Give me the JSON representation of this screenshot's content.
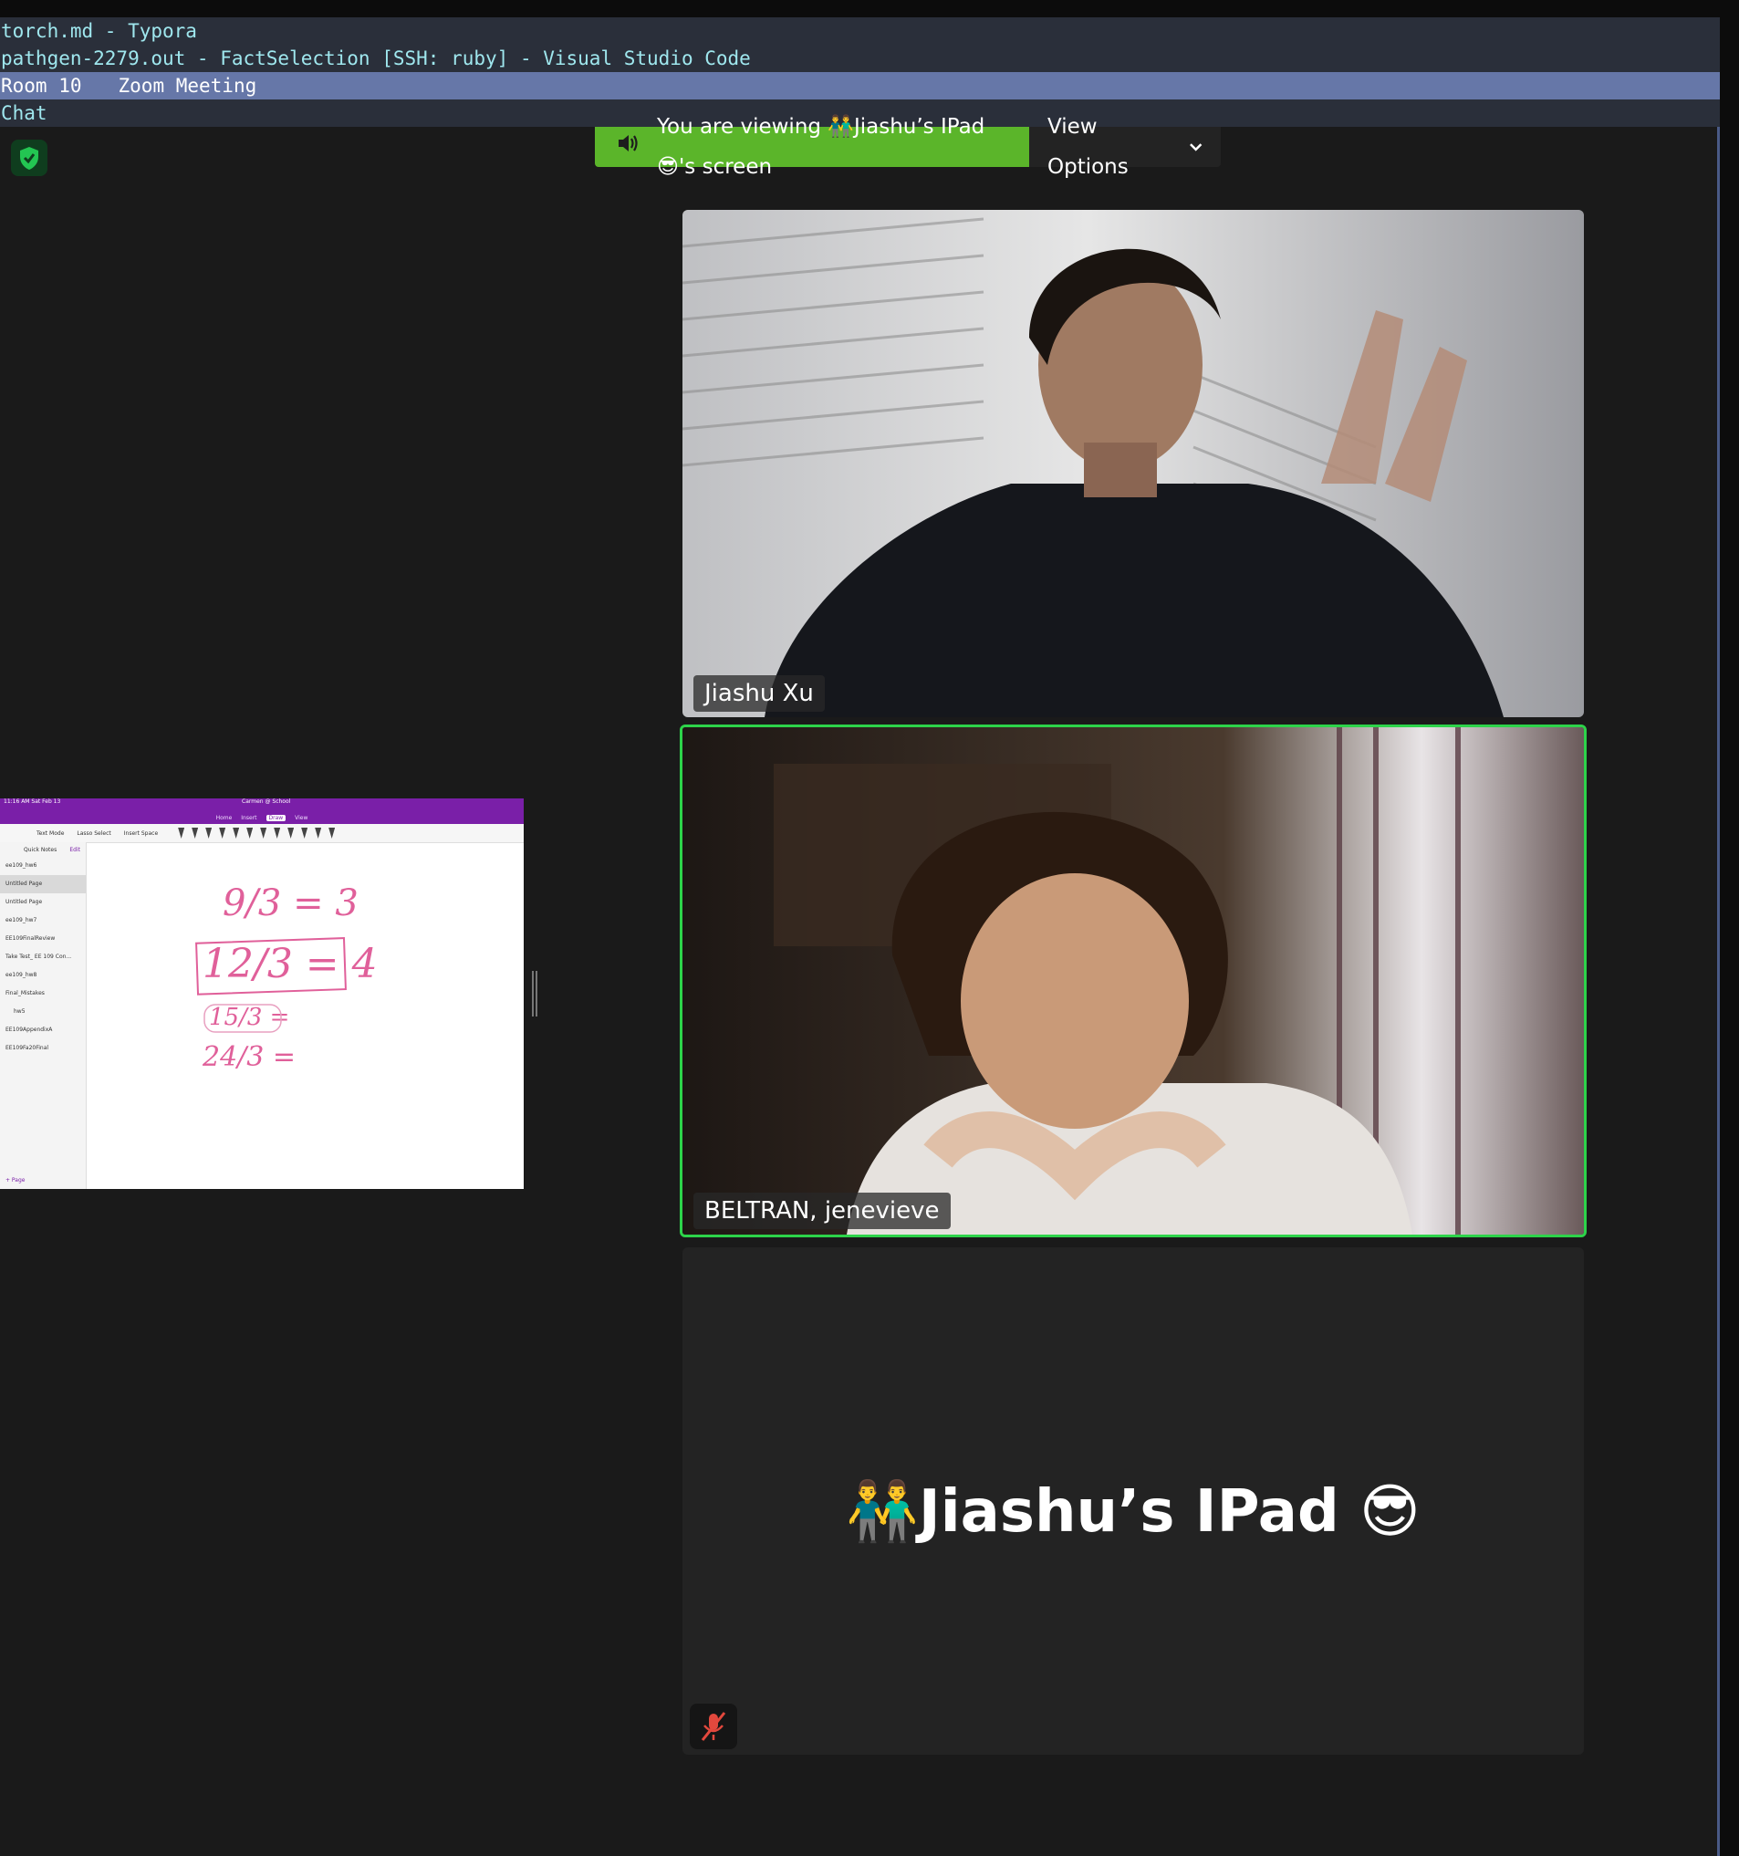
{
  "window_list": [
    {
      "title": "torch.md - Typora",
      "active": false
    },
    {
      "title": "pathgen-2279.out - FactSelection [SSH: ruby] - Visual Studio Code",
      "active": false
    },
    {
      "title": "Room 10",
      "title2": "Zoom Meeting",
      "active": true
    },
    {
      "title": "Chat",
      "active": false
    }
  ],
  "share_bar": {
    "viewing_text": "You are viewing 👬Jiashu’s IPad 😎's screen",
    "view_options_label": "View Options"
  },
  "shared_screen": {
    "status_left": "11:16 AM  Sat Feb 13",
    "app_title": "Carmen @ School",
    "tabs": [
      "Home",
      "Insert",
      "Draw",
      "View"
    ],
    "active_tab": "Draw",
    "tools": [
      "Text Mode",
      "Lasso Select",
      "Insert Space"
    ],
    "sidebar_header": "Quick Notes",
    "sidebar_edit": "Edit",
    "pages": [
      {
        "label": "ee109_hw6",
        "selected": false,
        "sub": false
      },
      {
        "label": "Untitled Page",
        "selected": true,
        "sub": false
      },
      {
        "label": "Untitled Page",
        "selected": false,
        "sub": false
      },
      {
        "label": "ee109_hw7",
        "selected": false,
        "sub": false
      },
      {
        "label": "EE109FinalReview",
        "selected": false,
        "sub": false
      },
      {
        "label": "Take Test_ EE 109 Con...",
        "selected": false,
        "sub": false
      },
      {
        "label": "ee109_hw8",
        "selected": false,
        "sub": false
      },
      {
        "label": "Final_Mistakes",
        "selected": false,
        "sub": false
      },
      {
        "label": "hw5",
        "selected": false,
        "sub": true
      },
      {
        "label": "EE109AppendixA",
        "selected": false,
        "sub": false
      },
      {
        "label": "EE109Fa20Final",
        "selected": false,
        "sub": false
      }
    ],
    "add_page": "+  Page",
    "handwriting": [
      "9/3 = 3",
      "12/3 = 4",
      "15/3 =",
      "24/3 ="
    ]
  },
  "participants": [
    {
      "name": "Jiashu Xu",
      "video": true,
      "speaking": false
    },
    {
      "name": "BELTRAN, jenevieve",
      "video": true,
      "speaking": true
    },
    {
      "name": "👬Jiashu’s IPad 😎",
      "video": false,
      "muted": true
    }
  ],
  "colors": {
    "window_bar": "#2a2f3a",
    "window_active": "#6677a8",
    "window_text": "#9fe7ee",
    "share_green": "#5bb52a",
    "speaking_border": "#2dd34a",
    "onenote_purple": "#7a1fa8",
    "ink_pink": "#e0609a"
  },
  "icons": [
    "shield-check-icon",
    "speaker-icon",
    "chevron-down-icon",
    "mic-muted-icon"
  ]
}
